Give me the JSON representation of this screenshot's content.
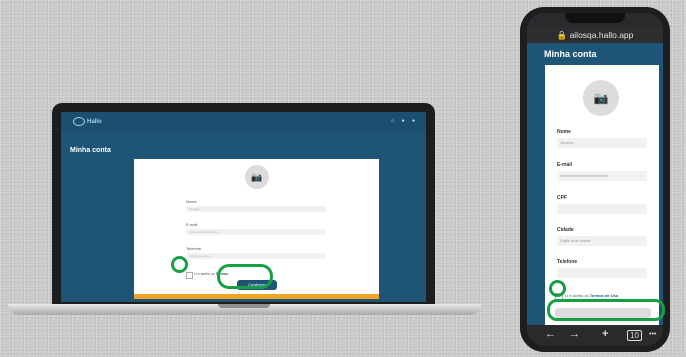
{
  "laptop": {
    "logo": "Hallo",
    "top_icons": "⌂ ● ●",
    "page_title": "Minha conta",
    "camera_glyph": "📷",
    "fields": [
      {
        "label": "Nome",
        "value": "Jéssica"
      },
      {
        "label": "E-mail",
        "value": "xxxxxxxxxxxxxxxxxxx"
      },
      {
        "label": "Telefone",
        "value": "(xx) xxxxx-xxxx"
      }
    ],
    "terms_prefix": "Li e aceito os",
    "terms_link": "Termos",
    "save_label": "Confirmar"
  },
  "phone": {
    "url": "🔒 ailosqa.hallo.app",
    "page_title": "Minha conta",
    "camera_glyph": "📷",
    "fields": [
      {
        "label": "Nome",
        "value": "Jéssica"
      },
      {
        "label": "E-mail",
        "value": "xxxxxxxxxxxxxxxxxxxxxxxx"
      },
      {
        "label": "CPF",
        "value": ""
      },
      {
        "label": "Cidade",
        "value": "Digite sua cidade"
      },
      {
        "label": "Telefone",
        "value": ""
      }
    ],
    "terms_prefix": "Li e aceito os",
    "terms_link": "Termos de Uso",
    "bottom": {
      "back": "←",
      "forward": "→",
      "new_tab": "+",
      "tabs": "10",
      "more": "•••"
    }
  },
  "colors": {
    "accent": "#17a043",
    "brand": "#1e5577",
    "orange": "#f0a528"
  }
}
